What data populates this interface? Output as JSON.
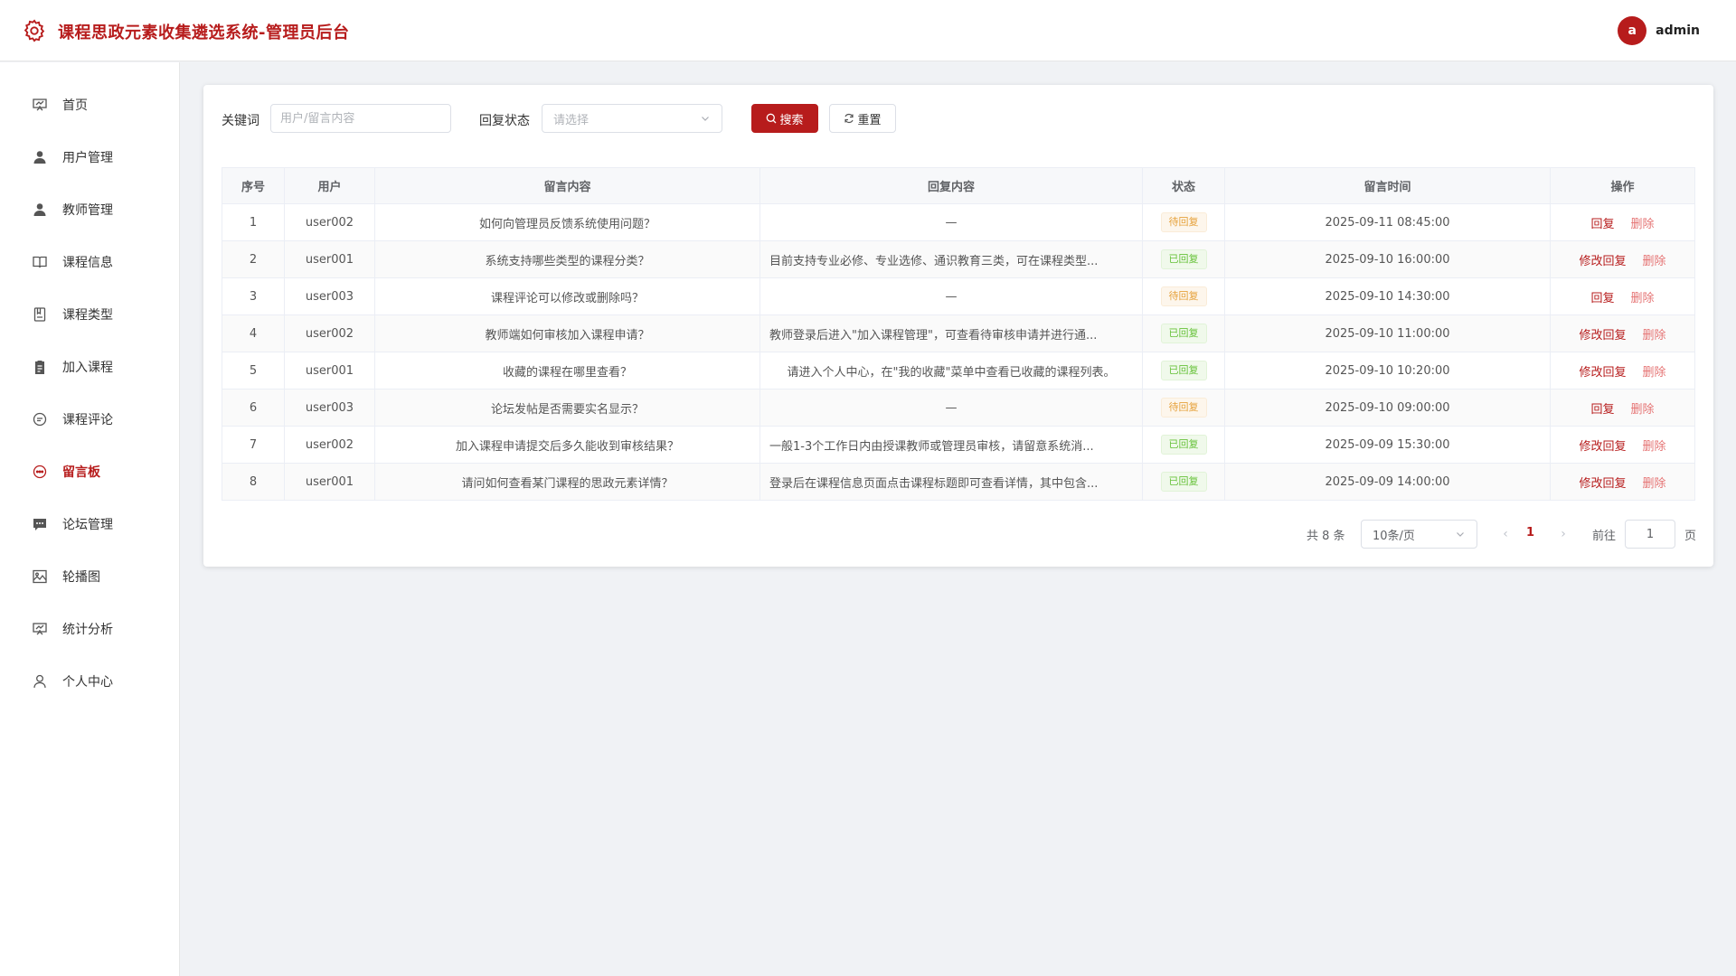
{
  "header": {
    "title": "课程思政元素收集遴选系统-管理员后台",
    "avatar_letter": "a",
    "username": "admin"
  },
  "sidebar": {
    "items": [
      {
        "label": "首页",
        "icon": "presentation-icon",
        "active": false
      },
      {
        "label": "用户管理",
        "icon": "user-icon",
        "active": false
      },
      {
        "label": "教师管理",
        "icon": "user-icon",
        "active": false
      },
      {
        "label": "课程信息",
        "icon": "book-icon",
        "active": false
      },
      {
        "label": "课程类型",
        "icon": "notebook-icon",
        "active": false
      },
      {
        "label": "加入课程",
        "icon": "clipboard-icon",
        "active": false
      },
      {
        "label": "课程评论",
        "icon": "chat-bubble-icon",
        "active": false
      },
      {
        "label": "留言板",
        "icon": "chat-dots-icon",
        "active": true
      },
      {
        "label": "论坛管理",
        "icon": "message-box-icon",
        "active": false
      },
      {
        "label": "轮播图",
        "icon": "picture-icon",
        "active": false
      },
      {
        "label": "统计分析",
        "icon": "data-board-icon",
        "active": false
      },
      {
        "label": "个人中心",
        "icon": "user-outline-icon",
        "active": false
      }
    ]
  },
  "filters": {
    "keyword_label": "关键词",
    "keyword_placeholder": "用户/留言内容",
    "keyword_value": "",
    "status_label": "回复状态",
    "status_placeholder": "请选择",
    "search_label": "搜索",
    "reset_label": "重置"
  },
  "table": {
    "headers": [
      "序号",
      "用户",
      "留言内容",
      "回复内容",
      "状态",
      "留言时间",
      "操作"
    ],
    "rows": [
      {
        "no": "1",
        "user": "user002",
        "content": "如何向管理员反馈系统使用问题？",
        "reply": "—",
        "status": "待回复",
        "time": "2025-09-11 08:45:00",
        "op1": "回复",
        "op2": "删除"
      },
      {
        "no": "2",
        "user": "user001",
        "content": "系统支持哪些类型的课程分类？",
        "reply": "目前支持专业必修、专业选修、通识教育三类，可在课程类型...",
        "status": "已回复",
        "time": "2025-09-10 16:00:00",
        "op1": "修改回复",
        "op2": "删除"
      },
      {
        "no": "3",
        "user": "user003",
        "content": "课程评论可以修改或删除吗？",
        "reply": "—",
        "status": "待回复",
        "time": "2025-09-10 14:30:00",
        "op1": "回复",
        "op2": "删除"
      },
      {
        "no": "4",
        "user": "user002",
        "content": "教师端如何审核加入课程申请？",
        "reply": "教师登录后进入\"加入课程管理\"，可查看待审核申请并进行通...",
        "status": "已回复",
        "time": "2025-09-10 11:00:00",
        "op1": "修改回复",
        "op2": "删除"
      },
      {
        "no": "5",
        "user": "user001",
        "content": "收藏的课程在哪里查看？",
        "reply": "请进入个人中心，在\"我的收藏\"菜单中查看已收藏的课程列表。",
        "status": "已回复",
        "time": "2025-09-10 10:20:00",
        "op1": "修改回复",
        "op2": "删除"
      },
      {
        "no": "6",
        "user": "user003",
        "content": "论坛发帖是否需要实名显示？",
        "reply": "—",
        "status": "待回复",
        "time": "2025-09-10 09:00:00",
        "op1": "回复",
        "op2": "删除"
      },
      {
        "no": "7",
        "user": "user002",
        "content": "加入课程申请提交后多久能收到审核结果？",
        "reply": "一般1-3个工作日内由授课教师或管理员审核，请留意系统消...",
        "status": "已回复",
        "time": "2025-09-09 15:30:00",
        "op1": "修改回复",
        "op2": "删除"
      },
      {
        "no": "8",
        "user": "user001",
        "content": "请问如何查看某门课程的思政元素详情？",
        "reply": "登录后在课程信息页面点击课程标题即可查看详情，其中包含...",
        "status": "已回复",
        "time": "2025-09-09 14:00:00",
        "op1": "修改回复",
        "op2": "删除"
      }
    ]
  },
  "pagination": {
    "total_text": "共 8 条",
    "page_size": "10条/页",
    "current_page": "1",
    "goto_label": "前往",
    "goto_value": "1",
    "page_suffix": "页"
  },
  "colors": {
    "brand": "#b71c1c",
    "pending": "#e6a23c",
    "replied": "#67c23a"
  }
}
